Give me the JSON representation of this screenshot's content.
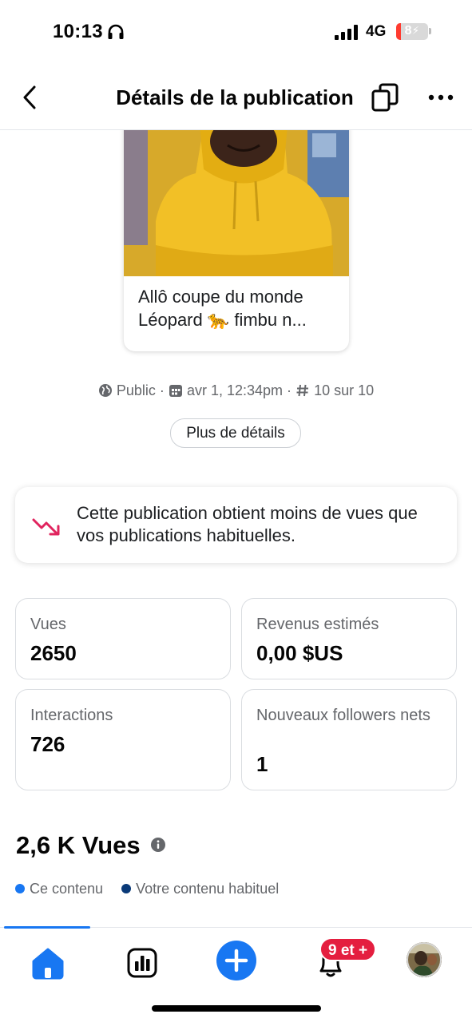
{
  "status_bar": {
    "time": "10:13",
    "network": "4G",
    "battery": "8"
  },
  "header": {
    "title": "Détails de la publication"
  },
  "post": {
    "caption": "Allô coupe du monde Léopard 🐆 fimbu n...",
    "visibility": "Public",
    "date": "avr 1, 12:34pm",
    "rank": "10 sur 10",
    "separator": "·",
    "details_button": "Plus de détails"
  },
  "insight": {
    "text": "Cette publication obtient moins de vues que vos publications habituelles."
  },
  "stats": [
    {
      "label": "Vues",
      "value": "2650"
    },
    {
      "label": "Revenus estimés",
      "value": "0,00 $US"
    },
    {
      "label": "Interactions",
      "value": "726"
    },
    {
      "label": "Nouveaux followers nets",
      "value": "1"
    }
  ],
  "views_section": {
    "title": "2,6 K Vues",
    "legend": [
      {
        "label": "Ce contenu",
        "color": "#1877f2"
      },
      {
        "label": "Votre contenu habituel",
        "color": "#0a3a78"
      }
    ]
  },
  "bottom_nav": {
    "items": [
      "home-icon",
      "insights-icon",
      "create-icon",
      "notifications-icon",
      "profile-avatar"
    ],
    "notifications_badge": "9 et +"
  },
  "colors": {
    "accent": "#1877f2",
    "alert": "#e41e3f",
    "trend_down": "#e0245e"
  }
}
